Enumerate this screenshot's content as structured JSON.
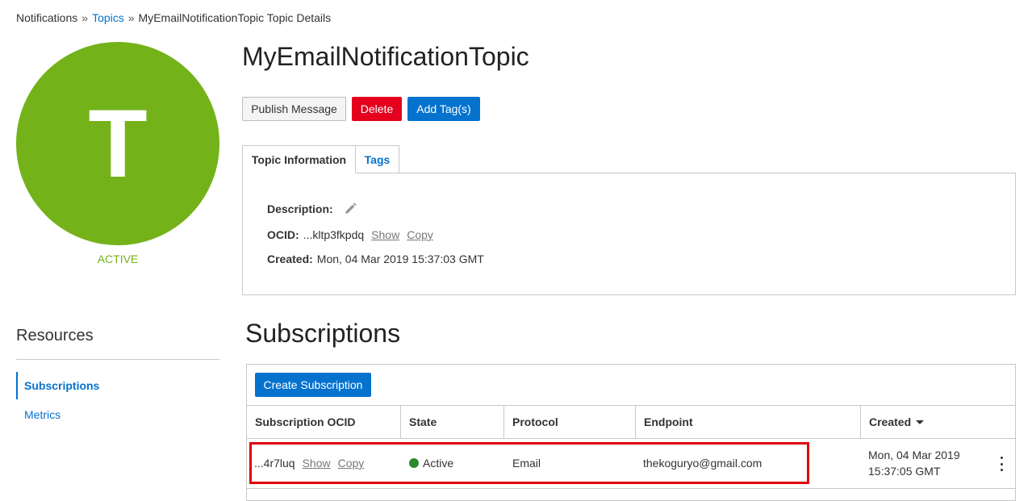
{
  "breadcrumb": {
    "root": "Notifications",
    "sep1": "»",
    "topics": "Topics",
    "sep2": "»",
    "current": "MyEmailNotificationTopic Topic Details"
  },
  "avatar": {
    "letter": "T",
    "status": "ACTIVE",
    "color": "#74b21a"
  },
  "topic": {
    "title": "MyEmailNotificationTopic",
    "buttons": {
      "publish": "Publish Message",
      "delete": "Delete",
      "add_tags": "Add Tag(s)"
    },
    "tabs": {
      "info": "Topic Information",
      "tags": "Tags"
    },
    "info": {
      "description_label": "Description:",
      "ocid_label": "OCID:",
      "ocid_value": "...kltp3fkpdq",
      "show": "Show",
      "copy": "Copy",
      "created_label": "Created:",
      "created_value": "Mon, 04 Mar 2019 15:37:03 GMT"
    }
  },
  "resources": {
    "title": "Resources",
    "items": [
      {
        "label": "Subscriptions",
        "active": true
      },
      {
        "label": "Metrics",
        "active": false
      }
    ]
  },
  "subscriptions": {
    "title": "Subscriptions",
    "create_button": "Create Subscription",
    "columns": [
      "Subscription OCID",
      "State",
      "Protocol",
      "Endpoint",
      "Created"
    ],
    "rows": [
      {
        "ocid": "...4r7luq",
        "show": "Show",
        "copy": "Copy",
        "state": "Active",
        "protocol": "Email",
        "endpoint": "thekoguryo@gmail.com",
        "created_date": "Mon, 04 Mar 2019",
        "created_time": "15:37:05 GMT"
      }
    ]
  },
  "colors": {
    "accent": "#0572ce",
    "danger": "#e5001d",
    "active_green": "#74b21a",
    "state_dot": "#2c8a2c",
    "highlight": "#e0000f"
  }
}
